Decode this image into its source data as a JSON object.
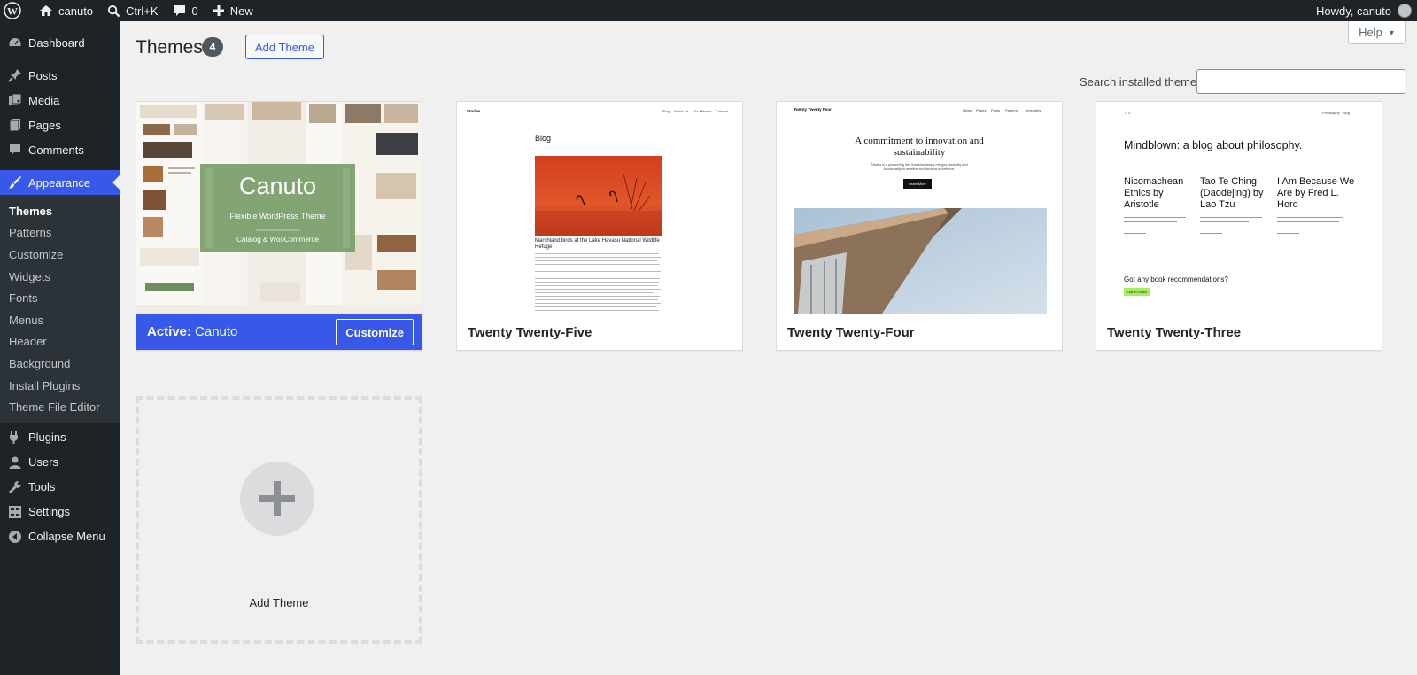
{
  "adminbar": {
    "site_name": "canuto",
    "search": "Ctrl+K",
    "comments_count": "0",
    "new_label": "New",
    "howdy": "Howdy, canuto"
  },
  "sidebar": {
    "items": [
      {
        "label": "Dashboard",
        "icon": "dashboard-icon"
      },
      {
        "label": "Posts",
        "icon": "pin-icon"
      },
      {
        "label": "Media",
        "icon": "media-icon"
      },
      {
        "label": "Pages",
        "icon": "pages-icon"
      },
      {
        "label": "Comments",
        "icon": "comment-icon"
      },
      {
        "label": "Appearance",
        "icon": "brush-icon"
      }
    ],
    "submenu": [
      "Themes",
      "Patterns",
      "Customize",
      "Widgets",
      "Fonts",
      "Menus",
      "Header",
      "Background",
      "Install Plugins",
      "Theme File Editor"
    ],
    "items2": [
      {
        "label": "Plugins",
        "icon": "plugin-icon"
      },
      {
        "label": "Users",
        "icon": "user-icon"
      },
      {
        "label": "Tools",
        "icon": "wrench-icon"
      },
      {
        "label": "Settings",
        "icon": "settings-icon"
      },
      {
        "label": "Collapse Menu",
        "icon": "collapse-icon"
      }
    ]
  },
  "header": {
    "title": "Themes",
    "count": "4",
    "add_theme": "Add Theme",
    "help": "Help",
    "search_label": "Search installed themes",
    "search_value": ""
  },
  "themes": [
    {
      "name": "Canuto",
      "active_prefix": "Active:",
      "customize": "Customize",
      "shot_title": "Canuto",
      "shot_subtitle": "Flexible WordPress Theme",
      "shot_tagline": "Catalog & WooCommerce"
    },
    {
      "name": "Twenty Twenty-Five",
      "shot_brand": "Stories",
      "shot_nav": [
        "Blog",
        "About Us",
        "Our Mission",
        "Contact"
      ],
      "shot_heading": "Blog",
      "shot_caption": "Marshland birds at the Lake Havasu National Wildlife Refuge"
    },
    {
      "name": "Twenty Twenty-Four",
      "shot_brand": "Twenty Twenty Four",
      "shot_nav": [
        "News",
        "Pages",
        "Posts",
        "Patterns",
        "Templates"
      ],
      "shot_heading": "A commitment to innovation and sustainability",
      "shot_text": "Études is a pioneering firm that seamlessly merges creativity and functionality to redefine architectural excellence.",
      "shot_button": "Learn More"
    },
    {
      "name": "Twenty Twenty-Three",
      "shot_brand": "TT3",
      "shot_nav": [
        "Philosophy",
        "Blog"
      ],
      "shot_heading": "Mindblown: a blog about philosophy.",
      "shot_posts": [
        "Nicomachean Ethics by Aristotle",
        "Tao Te Ching (Daodejing) by Lao Tzu",
        "I Am Because We Are by Fred L. Hord"
      ],
      "shot_cta": "Got any book recommendations?",
      "shot_button": "Get In Touch"
    }
  ],
  "add_new": {
    "label": "Add Theme"
  },
  "colors": {
    "accent": "#3858e9",
    "adminbar": "#1d2327",
    "submenu": "#2c3338",
    "background": "#f0f0f1"
  }
}
